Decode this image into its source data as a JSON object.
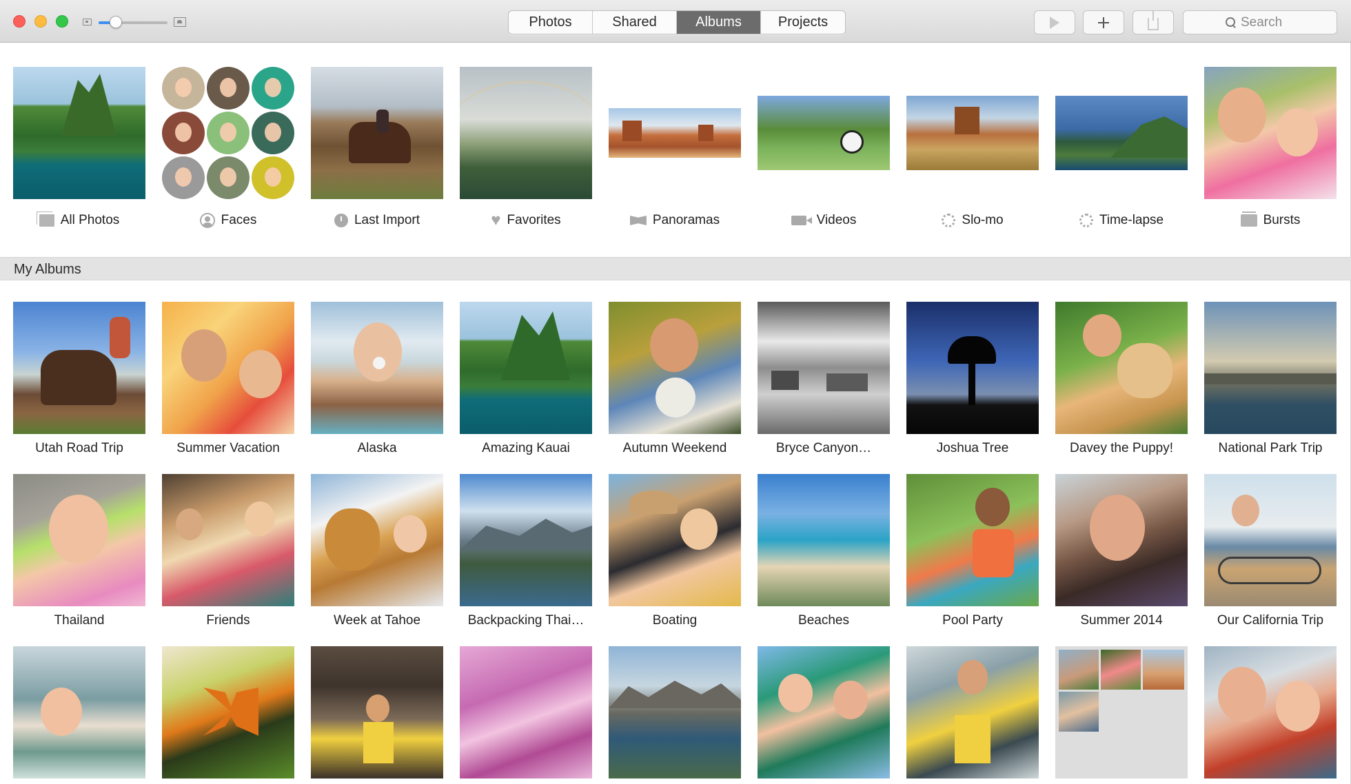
{
  "toolbar": {
    "tabs": [
      {
        "label": "Photos",
        "active": false
      },
      {
        "label": "Shared",
        "active": false
      },
      {
        "label": "Albums",
        "active": true
      },
      {
        "label": "Projects",
        "active": false
      }
    ],
    "zoom_level": 0.25,
    "search": {
      "placeholder": "Search"
    },
    "icons": [
      "play-icon",
      "add-icon",
      "share-icon",
      "search-icon"
    ]
  },
  "smart_albums": [
    {
      "label": "All Photos",
      "icon": "photo-stack-icon"
    },
    {
      "label": "Faces",
      "icon": "faces-icon"
    },
    {
      "label": "Last Import",
      "icon": "clock-icon"
    },
    {
      "label": "Favorites",
      "icon": "heart-icon"
    },
    {
      "label": "Panoramas",
      "icon": "panorama-icon"
    },
    {
      "label": "Videos",
      "icon": "video-camera-icon"
    },
    {
      "label": "Slo-mo",
      "icon": "slo-mo-icon"
    },
    {
      "label": "Time-lapse",
      "icon": "time-lapse-icon"
    },
    {
      "label": "Bursts",
      "icon": "bursts-icon"
    }
  ],
  "my_albums": {
    "title": "My Albums",
    "items": [
      {
        "label": "Utah Road Trip"
      },
      {
        "label": "Summer Vacation"
      },
      {
        "label": "Alaska"
      },
      {
        "label": "Amazing Kauai"
      },
      {
        "label": "Autumn Weekend"
      },
      {
        "label": "Bryce Canyon…"
      },
      {
        "label": "Joshua Tree"
      },
      {
        "label": "Davey the Puppy!"
      },
      {
        "label": "National Park Trip"
      },
      {
        "label": "Thailand"
      },
      {
        "label": "Friends"
      },
      {
        "label": "Week at Tahoe"
      },
      {
        "label": "Backpacking Thai…"
      },
      {
        "label": "Boating"
      },
      {
        "label": "Beaches"
      },
      {
        "label": "Pool Party"
      },
      {
        "label": "Summer 2014"
      },
      {
        "label": "Our California Trip"
      }
    ]
  },
  "colors": {
    "accent": "#3d8ff0",
    "active_tab": "#6c6c6c",
    "close": "#fc605b",
    "minimize": "#fdbc40",
    "zoom": "#34c84a"
  }
}
